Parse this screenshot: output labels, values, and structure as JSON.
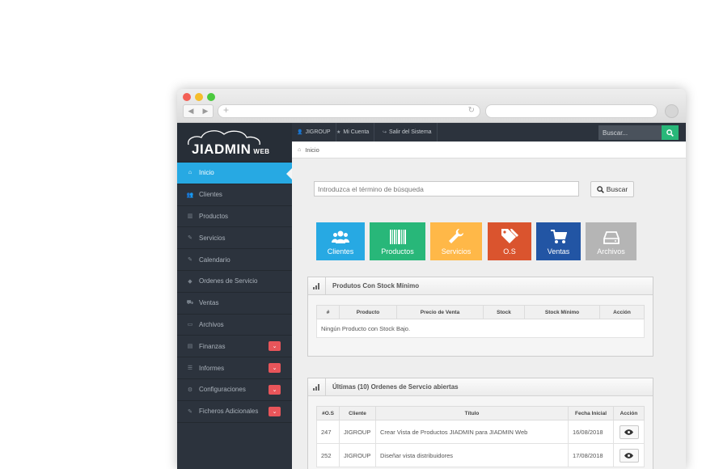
{
  "app": {
    "logo_text": "JIADMIN",
    "logo_sub": "WEB"
  },
  "sidebar": {
    "items": [
      {
        "label": "Inicio",
        "icon": "home-icon",
        "active": true
      },
      {
        "label": "Clientes",
        "icon": "users-icon"
      },
      {
        "label": "Productos",
        "icon": "barcode-icon"
      },
      {
        "label": "Servicios",
        "icon": "wrench-icon"
      },
      {
        "label": "Calendario",
        "icon": "wrench-icon"
      },
      {
        "label": "Ordenes de Servicio",
        "icon": "tag-icon"
      },
      {
        "label": "Ventas",
        "icon": "cart-icon"
      },
      {
        "label": "Archivos",
        "icon": "drive-icon"
      },
      {
        "label": "Finanzas",
        "icon": "money-icon",
        "badge": "⌄"
      },
      {
        "label": "Informes",
        "icon": "list-icon",
        "badge": "⌄"
      },
      {
        "label": "Configuraciones",
        "icon": "gear-icon",
        "badge": "⌄"
      },
      {
        "label": "Ficheros Adicionales",
        "icon": "wrench-icon",
        "badge": "⌄"
      }
    ]
  },
  "topbar": {
    "user": "JIGROUP",
    "account": "Mi Cuenta",
    "logout": "Salir del Sistema",
    "search_placeholder": "Buscar..."
  },
  "breadcrumb": {
    "home": "Inicio"
  },
  "search": {
    "placeholder": "Introduzca el término de búsqueda",
    "button": "Buscar"
  },
  "tiles": [
    {
      "label": "Clientes",
      "color": "#27a9e3"
    },
    {
      "label": "Productos",
      "color": "#28b779"
    },
    {
      "label": "Servicios",
      "color": "#ffb848"
    },
    {
      "label": "O.S",
      "color": "#da542e"
    },
    {
      "label": "Ventas",
      "color": "#2255a4"
    },
    {
      "label": "Archivos",
      "color": "#b5b5b5"
    }
  ],
  "stock_panel": {
    "title": "Produtos Con Stock Mínimo",
    "columns": [
      "#",
      "Producto",
      "Precio de Venta",
      "Stock",
      "Stock Mínimo",
      "Acción"
    ],
    "empty": "Ningún Producto con Stock Bajo."
  },
  "orders_panel": {
    "title": "Últimas (10) Ordenes de Servcio abiertas",
    "columns": [
      "#O.S",
      "Cliente",
      "Título",
      "Fecha Inicial",
      "Acción"
    ],
    "rows": [
      {
        "id": "247",
        "client": "JIGROUP",
        "title": "Crear Vista de Productos JIADMIN para JIADMIN Web",
        "date": "16/08/2018"
      },
      {
        "id": "252",
        "client": "JIGROUP",
        "title": "Diseñar vista distribuidores",
        "date": "17/08/2018"
      }
    ]
  }
}
